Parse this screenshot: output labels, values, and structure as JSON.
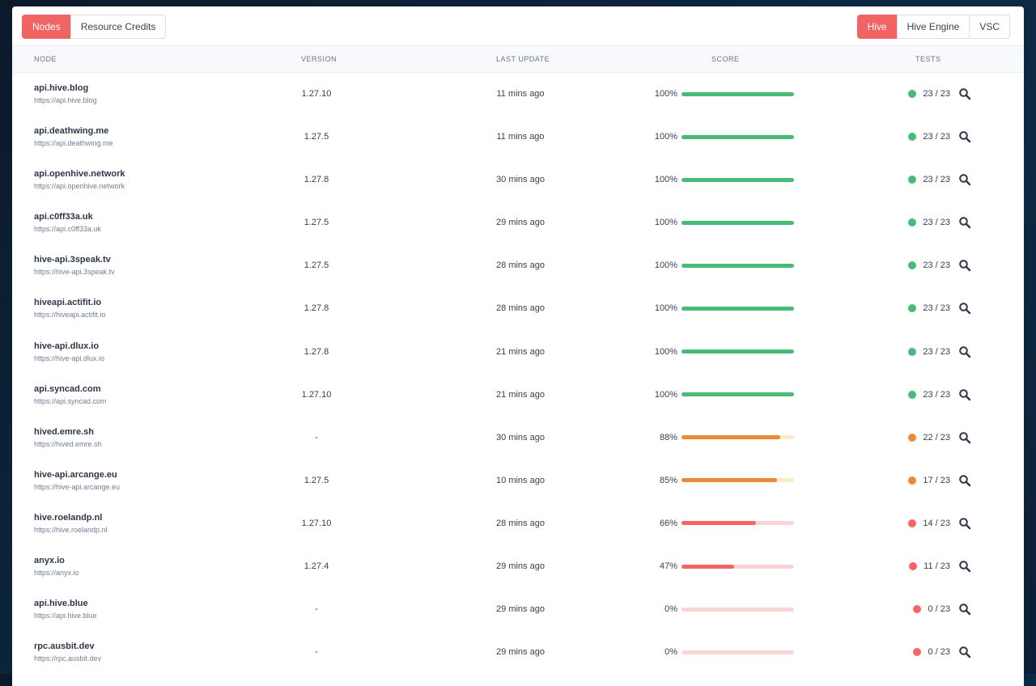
{
  "tabs_left": [
    {
      "label": "Nodes",
      "active": true
    },
    {
      "label": "Resource Credits",
      "active": false
    }
  ],
  "tabs_right": [
    {
      "label": "Hive",
      "active": true
    },
    {
      "label": "Hive Engine",
      "active": false
    },
    {
      "label": "VSC",
      "active": false
    }
  ],
  "columns": {
    "node": "NODE",
    "version": "VERSION",
    "last_update": "LAST UPDATE",
    "score": "SCORE",
    "tests": "TESTS"
  },
  "status_colors": {
    "good": "#48bb78",
    "warn": "#ed8936",
    "bad": "#f56565"
  },
  "rows": [
    {
      "name": "api.hive.blog",
      "url": "https://api.hive.blog",
      "version": "1.27.10",
      "updated": "11 mins ago",
      "score": 100,
      "score_label": "100%",
      "tests": "23 / 23",
      "status": "good"
    },
    {
      "name": "api.deathwing.me",
      "url": "https://api.deathwing.me",
      "version": "1.27.5",
      "updated": "11 mins ago",
      "score": 100,
      "score_label": "100%",
      "tests": "23 / 23",
      "status": "good"
    },
    {
      "name": "api.openhive.network",
      "url": "https://api.openhive.network",
      "version": "1.27.8",
      "updated": "30 mins ago",
      "score": 100,
      "score_label": "100%",
      "tests": "23 / 23",
      "status": "good"
    },
    {
      "name": "api.c0ff33a.uk",
      "url": "https://api.c0ff33a.uk",
      "version": "1.27.5",
      "updated": "29 mins ago",
      "score": 100,
      "score_label": "100%",
      "tests": "23 / 23",
      "status": "good"
    },
    {
      "name": "hive-api.3speak.tv",
      "url": "https://hive-api.3speak.tv",
      "version": "1.27.5",
      "updated": "28 mins ago",
      "score": 100,
      "score_label": "100%",
      "tests": "23 / 23",
      "status": "good"
    },
    {
      "name": "hiveapi.actifit.io",
      "url": "https://hiveapi.actifit.io",
      "version": "1.27.8",
      "updated": "28 mins ago",
      "score": 100,
      "score_label": "100%",
      "tests": "23 / 23",
      "status": "good"
    },
    {
      "name": "hive-api.dlux.io",
      "url": "https://hive-api.dlux.io",
      "version": "1.27.8",
      "updated": "21 mins ago",
      "score": 100,
      "score_label": "100%",
      "tests": "23 / 23",
      "status": "good"
    },
    {
      "name": "api.syncad.com",
      "url": "https://api.syncad.com",
      "version": "1.27.10",
      "updated": "21 mins ago",
      "score": 100,
      "score_label": "100%",
      "tests": "23 / 23",
      "status": "good"
    },
    {
      "name": "hived.emre.sh",
      "url": "https://hived.emre.sh",
      "version": "-",
      "updated": "30 mins ago",
      "score": 88,
      "score_label": "88%",
      "tests": "22 / 23",
      "status": "warn"
    },
    {
      "name": "hive-api.arcange.eu",
      "url": "https://hive-api.arcange.eu",
      "version": "1.27.5",
      "updated": "10 mins ago",
      "score": 85,
      "score_label": "85%",
      "tests": "17 / 23",
      "status": "warn"
    },
    {
      "name": "hive.roelandp.nl",
      "url": "https://hive.roelandp.nl",
      "version": "1.27.10",
      "updated": "28 mins ago",
      "score": 66,
      "score_label": "66%",
      "tests": "14 / 23",
      "status": "bad"
    },
    {
      "name": "anyx.io",
      "url": "https://anyx.io",
      "version": "1.27.4",
      "updated": "29 mins ago",
      "score": 47,
      "score_label": "47%",
      "tests": "11 / 23",
      "status": "bad"
    },
    {
      "name": "api.hive.blue",
      "url": "https://api.hive.blue",
      "version": "-",
      "updated": "29 mins ago",
      "score": 0,
      "score_label": "0%",
      "tests": "0 / 23",
      "status": "bad"
    },
    {
      "name": "rpc.ausbit.dev",
      "url": "https://rpc.ausbit.dev",
      "version": "-",
      "updated": "29 mins ago",
      "score": 0,
      "score_label": "0%",
      "tests": "0 / 23",
      "status": "bad"
    }
  ],
  "icons": {
    "tests_action": "search-icon"
  }
}
